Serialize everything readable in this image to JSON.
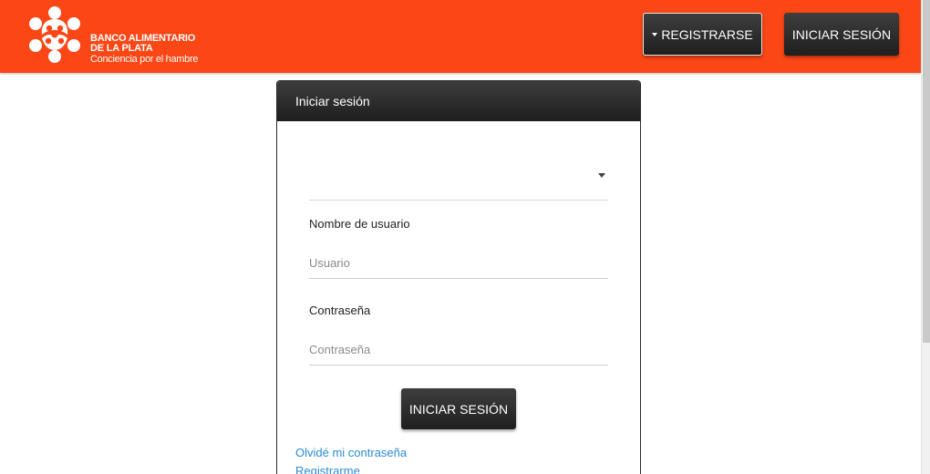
{
  "header": {
    "brand_line1": "BANCO ALIMENTARIO",
    "brand_line2": "DE LA PLATA",
    "brand_tagline": "Conciencia por el hambre",
    "register_button": "REGISTRARSE",
    "login_button": "INICIAR SESIÓN",
    "icons": {
      "register_dropdown": "caret-down-icon",
      "logo": "people-circle-logo"
    }
  },
  "login_panel": {
    "title": "Iniciar sesión",
    "select": {
      "value": "",
      "icon": "caret-down-icon"
    },
    "username": {
      "label": "Nombre de usuario",
      "placeholder": "Usuario",
      "value": ""
    },
    "password": {
      "label": "Contraseña",
      "placeholder": "Contraseña",
      "value": ""
    },
    "submit_button": "INICIAR SESIÓN",
    "forgot_password_link": "Olvidé mi contraseña",
    "register_link": "Registrarme"
  },
  "colors": {
    "brand_orange": "#fb4615",
    "dark_button": "#2a2a2a",
    "link_blue": "#2a8ad4"
  }
}
